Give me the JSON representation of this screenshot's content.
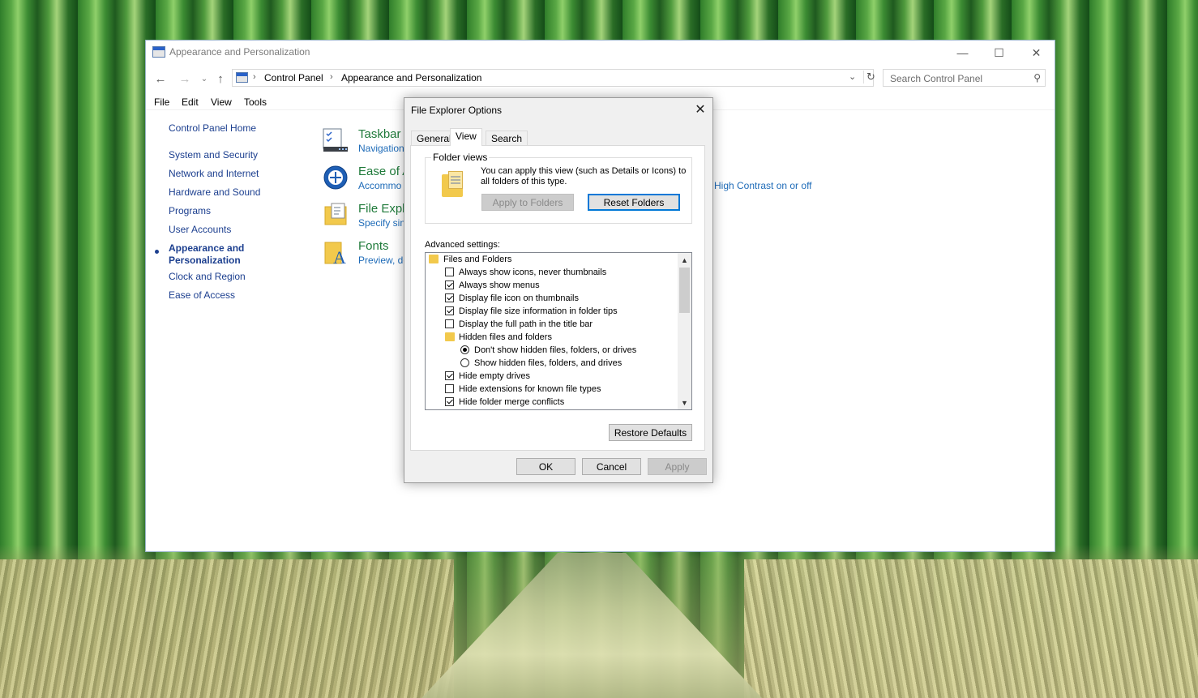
{
  "window": {
    "title": "Appearance and Personalization",
    "minimize_symbol": "—",
    "maximize_symbol": "☐",
    "close_symbol": "✕"
  },
  "address": {
    "crumb1": "Control Panel",
    "crumb2": "Appearance and Personalization",
    "separator": "›",
    "search_placeholder": "Search Control Panel"
  },
  "menu": [
    "File",
    "Edit",
    "View",
    "Tools"
  ],
  "sidebar": {
    "home": "Control Panel Home",
    "items": [
      "System and Security",
      "Network and Internet",
      "Hardware and Sound",
      "Programs",
      "User Accounts",
      "Appearance and Personalization",
      "Clock and Region",
      "Ease of Access"
    ]
  },
  "categories": [
    {
      "title": "Taskbar and Navigation",
      "sub": "Navigation",
      "icon": "taskbar-icon"
    },
    {
      "title": "Ease of Access Center",
      "sub": "Accommodate",
      "extra_link": "rn High Contrast on or off",
      "icon": "ease-of-access-icon"
    },
    {
      "title": "File Explorer Options",
      "sub": "Specify single",
      "icon": "file-explorer-options-icon"
    },
    {
      "title": "Fonts",
      "sub": "Preview, de",
      "icon": "fonts-icon"
    }
  ],
  "dialog": {
    "title": "File Explorer Options",
    "tabs": [
      "General",
      "View",
      "Search"
    ],
    "active_tab": "View",
    "folder_views": {
      "label": "Folder views",
      "text": "You can apply this view (such as Details or Icons) to all folders of this type.",
      "apply_button": "Apply to Folders",
      "reset_button": "Reset Folders"
    },
    "advanced_label": "Advanced settings:",
    "advanced_items": [
      {
        "type": "folder",
        "label": "Files and Folders",
        "level": 0
      },
      {
        "type": "checkbox",
        "label": "Always show icons, never thumbnails",
        "checked": false,
        "level": 1
      },
      {
        "type": "checkbox",
        "label": "Always show menus",
        "checked": true,
        "level": 1
      },
      {
        "type": "checkbox",
        "label": "Display file icon on thumbnails",
        "checked": true,
        "level": 1
      },
      {
        "type": "checkbox",
        "label": "Display file size information in folder tips",
        "checked": true,
        "level": 1
      },
      {
        "type": "checkbox",
        "label": "Display the full path in the title bar",
        "checked": false,
        "level": 1
      },
      {
        "type": "folder",
        "label": "Hidden files and folders",
        "level": 1
      },
      {
        "type": "radio",
        "label": "Don't show hidden files, folders, or drives",
        "checked": true,
        "level": 2
      },
      {
        "type": "radio",
        "label": "Show hidden files, folders, and drives",
        "checked": false,
        "level": 2
      },
      {
        "type": "checkbox",
        "label": "Hide empty drives",
        "checked": true,
        "level": 1
      },
      {
        "type": "checkbox",
        "label": "Hide extensions for known file types",
        "checked": false,
        "level": 1
      },
      {
        "type": "checkbox",
        "label": "Hide folder merge conflicts",
        "checked": true,
        "level": 1
      }
    ],
    "restore_button": "Restore Defaults",
    "ok_button": "OK",
    "cancel_button": "Cancel",
    "apply_button": "Apply"
  }
}
